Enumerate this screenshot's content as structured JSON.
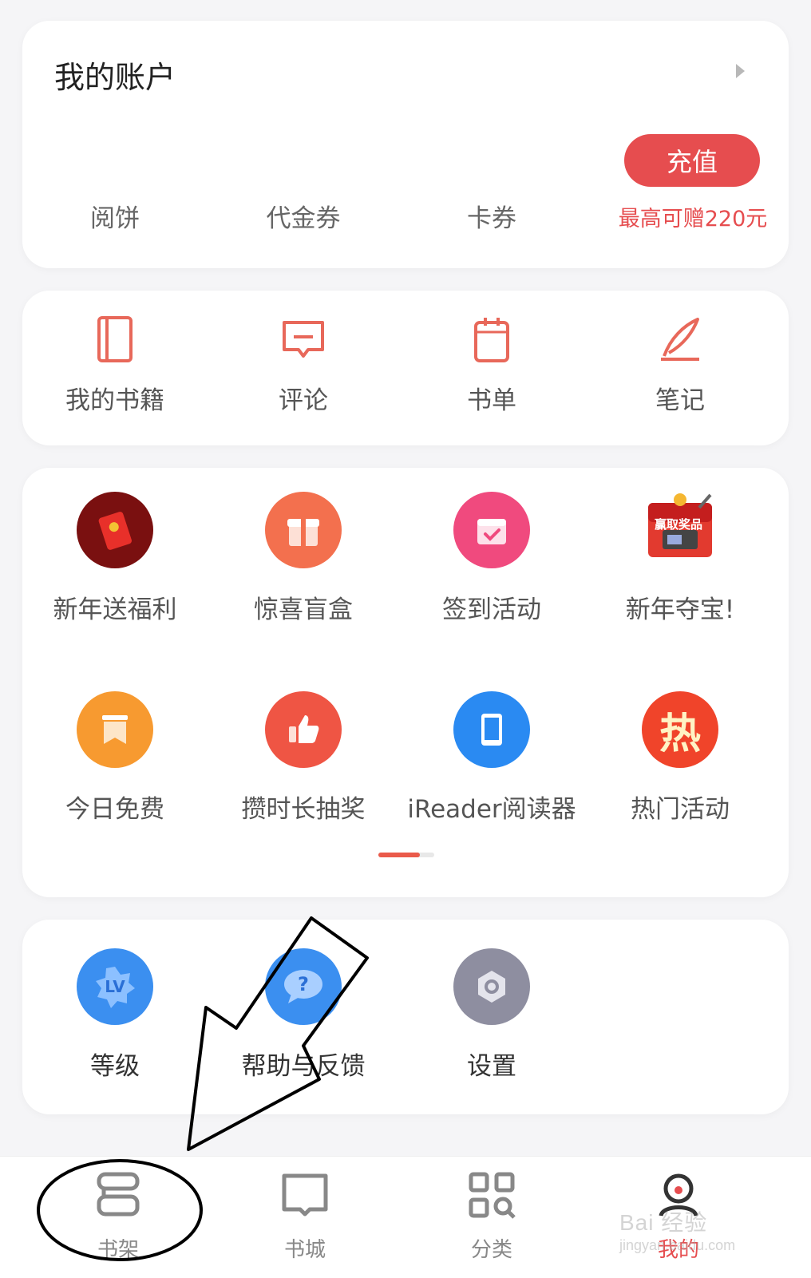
{
  "account": {
    "title": "我的账户",
    "recharge_label": "充值",
    "promo": "最高可赠220元",
    "items": [
      "阅饼",
      "代金券",
      "卡券"
    ]
  },
  "tools": [
    {
      "label": "我的书籍",
      "icon": "book-icon"
    },
    {
      "label": "评论",
      "icon": "comment-icon"
    },
    {
      "label": "书单",
      "icon": "booklist-icon"
    },
    {
      "label": "笔记",
      "icon": "pen-icon"
    }
  ],
  "activities": [
    {
      "label": "新年送福利",
      "icon": "red-envelope-icon"
    },
    {
      "label": "惊喜盲盒",
      "icon": "gift-box-icon"
    },
    {
      "label": "签到活动",
      "icon": "calendar-check-icon"
    },
    {
      "label": "新年夺宝!",
      "icon": "prize-icon",
      "badge": "赢取奖品"
    },
    {
      "label": "今日免费",
      "icon": "free-bookmark-icon"
    },
    {
      "label": "攒时长抽奖",
      "icon": "thumbs-up-icon"
    },
    {
      "label": "iReader阅读器",
      "icon": "ereader-icon"
    },
    {
      "label": "热门活动",
      "icon": "hot-icon",
      "glyph": "热"
    }
  ],
  "misc": [
    {
      "label": "等级",
      "icon": "level-icon",
      "glyph": "LV"
    },
    {
      "label": "帮助与反馈",
      "icon": "help-icon",
      "glyph": "?"
    },
    {
      "label": "设置",
      "icon": "settings-icon"
    }
  ],
  "nav": [
    {
      "label": "书架",
      "icon": "bookshelf-icon"
    },
    {
      "label": "书城",
      "icon": "bookstore-icon"
    },
    {
      "label": "分类",
      "icon": "category-icon"
    },
    {
      "label": "我的",
      "icon": "profile-icon",
      "active": true
    }
  ],
  "watermark": {
    "line1": "Bai 经验",
    "line2": "jingyan.baidu.com"
  },
  "colors": {
    "accent": "#e64d4f",
    "background": "#f5f5f7"
  }
}
